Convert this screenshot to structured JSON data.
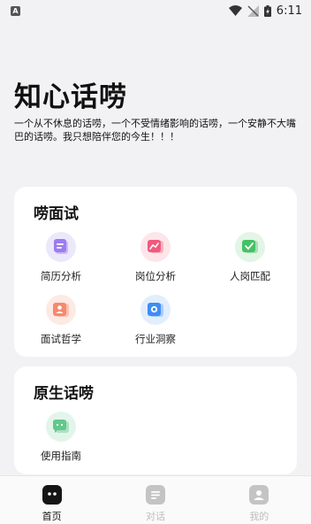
{
  "status_bar": {
    "time": "6:11",
    "notification_letter": "A"
  },
  "app": {
    "title": "知心话唠",
    "tagline": "一个从不休息的话唠，一个不受情绪影响的话唠，一个安静不大嘴巴的话唠。我只想陪伴您的今生！！！"
  },
  "interview_section": {
    "title": "唠面试",
    "items": [
      {
        "label": "简历分析",
        "icon": "resume-icon",
        "color": "#9b7cf0"
      },
      {
        "label": "岗位分析",
        "icon": "chart-icon",
        "color": "#f05a7d"
      },
      {
        "label": "人岗匹配",
        "icon": "check-icon",
        "color": "#45c166"
      },
      {
        "label": "面试哲学",
        "icon": "person-icon",
        "color": "#f6896e"
      },
      {
        "label": "行业洞察",
        "icon": "eye-icon",
        "color": "#3f8df2"
      }
    ]
  },
  "native_section": {
    "title": "原生话唠",
    "items": [
      {
        "label": "使用指南",
        "icon": "chat-icon",
        "color": "#63c78b"
      }
    ]
  },
  "tabbar": {
    "tabs": [
      {
        "label": "首页",
        "icon": "home-icon",
        "active": true
      },
      {
        "label": "对话",
        "icon": "dialog-icon",
        "active": false
      },
      {
        "label": "我的",
        "icon": "profile-icon",
        "active": false
      }
    ]
  }
}
